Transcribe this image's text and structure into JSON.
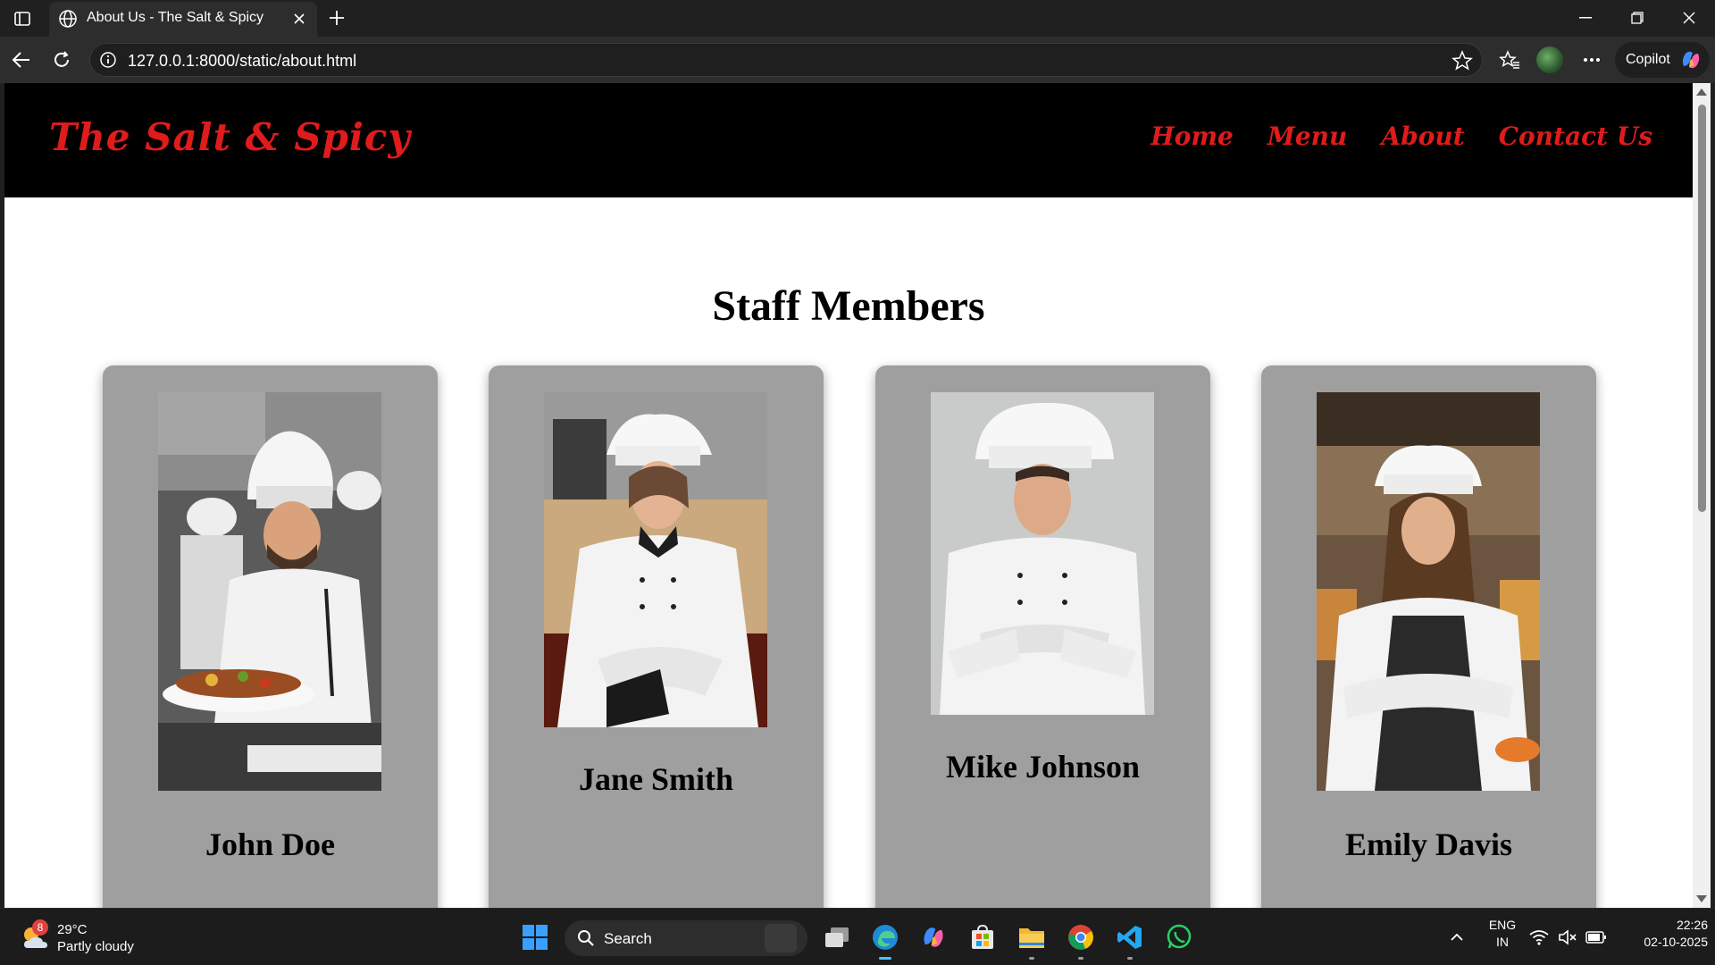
{
  "browser": {
    "tab_title": "About Us - The Salt & Spicy",
    "url": "127.0.0.1:8000/static/about.html",
    "copilot_label": "Copilot"
  },
  "site": {
    "logo": "The Salt & Spicy",
    "nav": [
      "Home",
      "Menu",
      "About",
      "Contact Us"
    ],
    "section_title": "Staff Members",
    "staff": [
      {
        "name": "John Doe",
        "photo_icon": "chef-photo-icon"
      },
      {
        "name": "Jane Smith",
        "photo_icon": "chef-photo-icon"
      },
      {
        "name": "Mike Johnson",
        "photo_icon": "chef-photo-icon"
      },
      {
        "name": "Emily Davis",
        "photo_icon": "chef-photo-icon"
      }
    ],
    "colors": {
      "brand_red": "#e01b1b",
      "header_bg": "#000000",
      "card_bg": "#a09f9f"
    }
  },
  "taskbar": {
    "weather_badge": "8",
    "temperature": "29°C",
    "weather_condition": "Partly cloudy",
    "search_label": "Search",
    "language": "ENG",
    "region": "IN",
    "time": "22:26",
    "date": "02-10-2025"
  }
}
